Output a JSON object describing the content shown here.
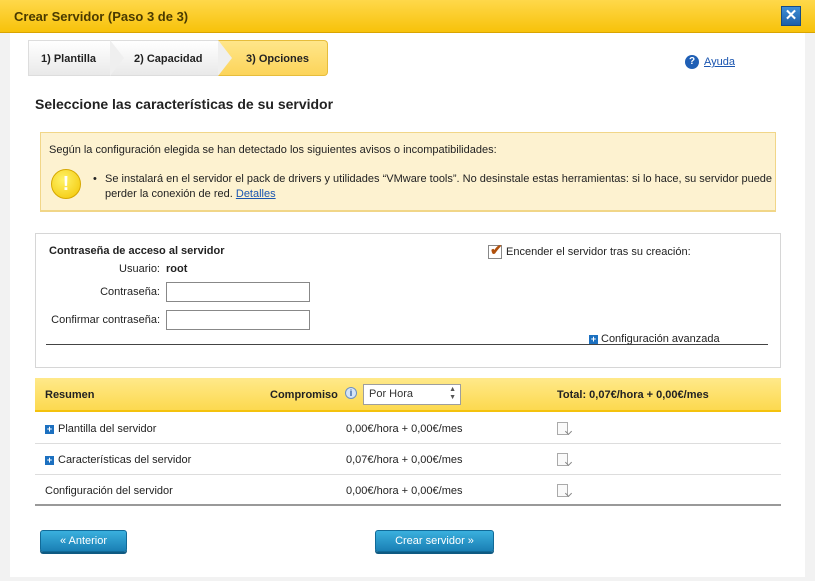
{
  "window": {
    "title": "Crear Servidor (Paso 3 de 3)",
    "close_label": "✕"
  },
  "steps": [
    {
      "label": "1) Plantilla"
    },
    {
      "label": "2) Capacidad"
    },
    {
      "label": "3) Opciones"
    }
  ],
  "help": {
    "label": "Ayuda",
    "icon": "?"
  },
  "heading": "Seleccione las características de su servidor",
  "warning": {
    "intro": "Según la configuración elegida se han detectado los siguientes avisos o incompatibilidades:",
    "message": "Se instalará en el servidor el pack de drivers y utilidades “VMware tools”. No desinstale estas herramientas: si lo hace, su servidor puede perder la conexión de red.",
    "link": "Detalles",
    "icon": "!"
  },
  "credentials": {
    "title": "Contraseña de acceso al servidor",
    "user_label": "Usuario:",
    "user_value": "root",
    "password_label": "Contraseña:",
    "confirm_label": "Confirmar contraseña:",
    "password_value": "",
    "confirm_value": "",
    "power_on_label": "Encender el servidor tras su creación:",
    "power_on_checked": true,
    "advanced_label": "Configuración avanzada"
  },
  "summary": {
    "header_summary": "Resumen",
    "header_commitment": "Compromiso",
    "commitment_value": "Por Hora",
    "header_total": "Total: 0,07€/hora + 0,00€/mes",
    "rows": [
      {
        "label": "Plantilla del servidor",
        "price": "0,00€/hora + 0,00€/mes",
        "expandable": true
      },
      {
        "label": "Características del servidor",
        "price": "0,07€/hora + 0,00€/mes",
        "expandable": true
      },
      {
        "label": "Configuración del servidor",
        "price": "0,00€/hora + 0,00€/mes",
        "expandable": false
      }
    ]
  },
  "buttons": {
    "previous": "« Anterior",
    "create": "Crear servidor »"
  }
}
